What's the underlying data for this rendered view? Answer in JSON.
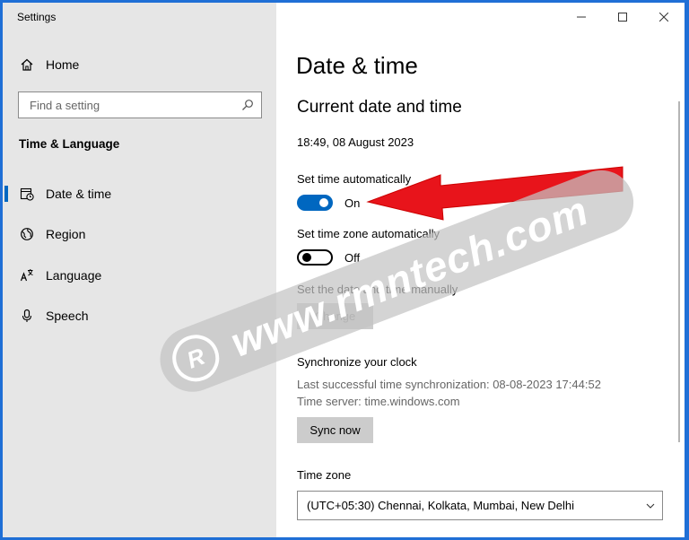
{
  "app_title": "Settings",
  "sidebar": {
    "home_label": "Home",
    "search_placeholder": "Find a setting",
    "section_heading": "Time & Language",
    "items": [
      {
        "label": "Date & time",
        "selected": true
      },
      {
        "label": "Region"
      },
      {
        "label": "Language"
      },
      {
        "label": "Speech"
      }
    ]
  },
  "main": {
    "title": "Date & time",
    "subtitle": "Current date and time",
    "current_datetime": "18:49, 08 August 2023",
    "auto_time": {
      "label": "Set time automatically",
      "state": "On",
      "on": true
    },
    "auto_timezone": {
      "label": "Set time zone automatically",
      "state": "Off",
      "on": false
    },
    "manual": {
      "label": "Set the date and time manually",
      "button": "Change"
    },
    "sync": {
      "heading": "Synchronize your clock",
      "last_sync": "Last successful time synchronization: 08-08-2023 17:44:52",
      "server": "Time server: time.windows.com",
      "button": "Sync now"
    },
    "timezone": {
      "label": "Time zone",
      "value": "(UTC+05:30) Chennai, Kolkata, Mumbai, New Delhi"
    }
  },
  "watermark": {
    "logo_letter": "R",
    "text": "www.rmntech.com"
  },
  "colors": {
    "accent": "#0067c0",
    "arrow": "#e8141b",
    "frame": "#1f6fd6"
  }
}
